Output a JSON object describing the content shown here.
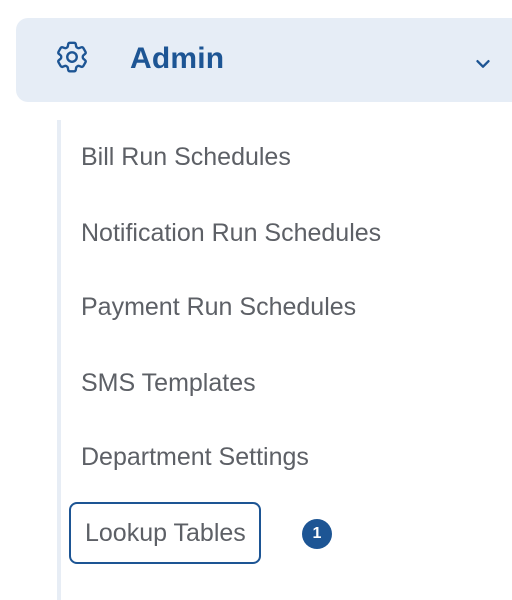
{
  "section": {
    "title": "Admin",
    "icon": "gear-icon",
    "expand_icon": "chevron-down-icon",
    "accent_color": "#1d5594",
    "background_color": "#e6edf6"
  },
  "submenu": {
    "items": [
      {
        "label": "Bill Run Schedules"
      },
      {
        "label": "Notification Run Schedules"
      },
      {
        "label": "Payment Run Schedules"
      },
      {
        "label": "SMS Templates"
      },
      {
        "label": "Department Settings"
      },
      {
        "label": "Lookup Tables",
        "focused": true,
        "badge": "1"
      }
    ]
  }
}
